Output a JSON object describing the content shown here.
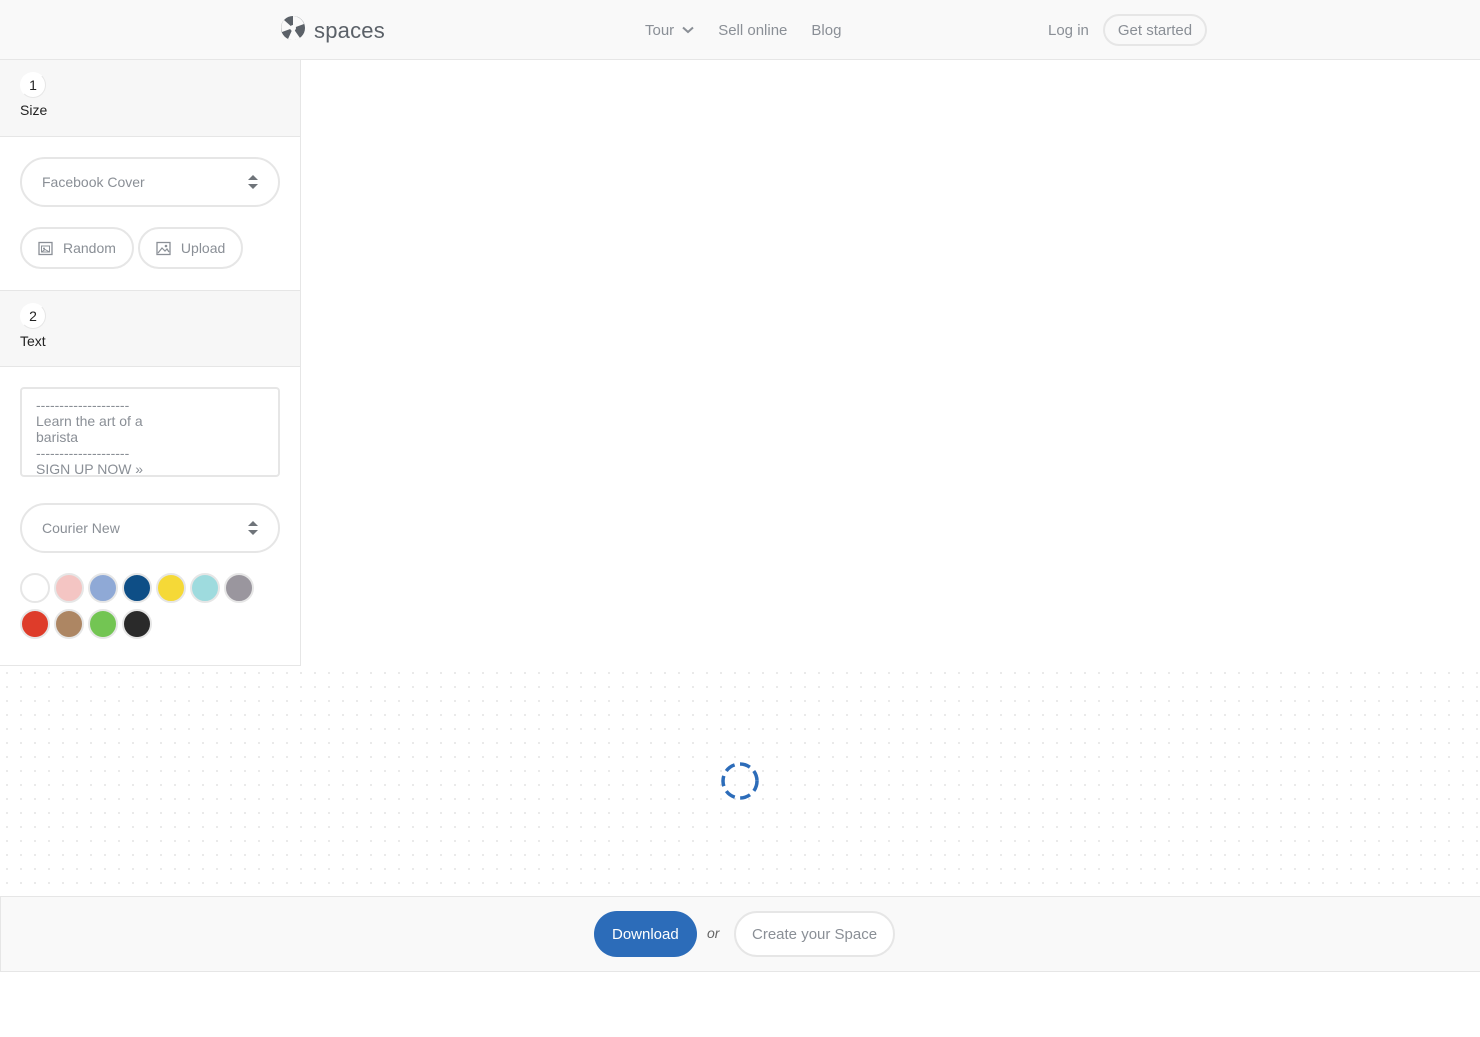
{
  "brand": {
    "name": "spaces"
  },
  "nav": {
    "tour": "Tour",
    "sell_online": "Sell online",
    "blog": "Blog",
    "login": "Log in",
    "get_started": "Get started"
  },
  "steps": {
    "size": {
      "number": "1",
      "label": "Size"
    },
    "text": {
      "number": "2",
      "label": "Text"
    }
  },
  "size_select": {
    "value": "Facebook Cover"
  },
  "image_buttons": {
    "random": "Random",
    "upload": "Upload"
  },
  "text_input": {
    "value": "--------------------\nLearn the art of a\nbarista\n--------------------\nSIGN UP NOW »"
  },
  "font_select": {
    "value": "Courier New"
  },
  "swatch_colors": [
    "#ffffff",
    "#f4c5c3",
    "#8fa9d6",
    "#0e4e86",
    "#f5d937",
    "#9edbde",
    "#9a969e",
    "#de3c2a",
    "#ad8663",
    "#73c553",
    "#2a2a2a"
  ],
  "accent_color": "#2c6cb9",
  "actions": {
    "download": "Download",
    "or": "or",
    "create": "Create your Space"
  },
  "loading": {
    "icon": "spinner-icon"
  }
}
